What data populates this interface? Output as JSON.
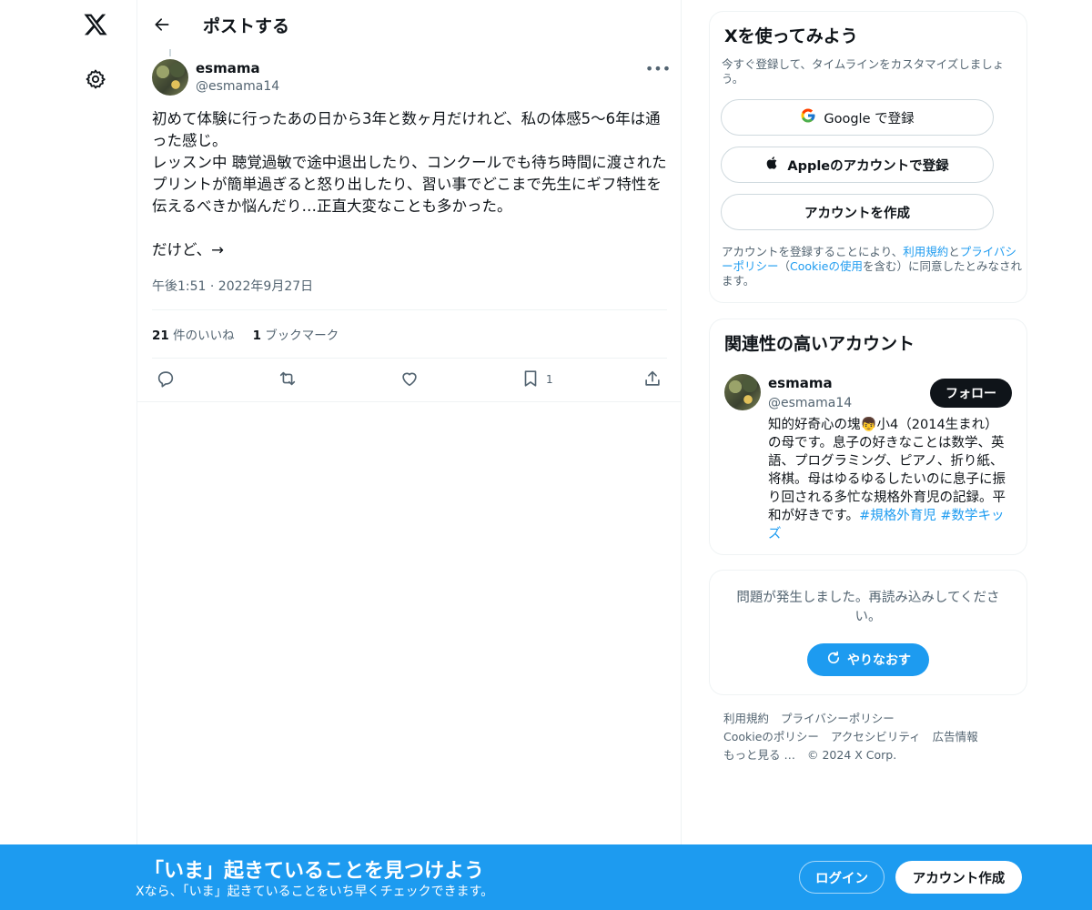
{
  "header": {
    "title": "ポストする"
  },
  "post": {
    "author_name": "esmama",
    "author_handle": "@esmama14",
    "more_label": "•••",
    "text_paragraphs": [
      "初めて体験に行ったあの日から3年と数ヶ月だけれど、私の体感5〜6年は通った感じ。\nレッスン中 聴覚過敏で途中退出したり、コンクールでも待ち時間に渡されたプリントが簡単過ぎると怒り出したり、習い事でどこまで先生にギフ特性を伝えるべきか悩んだり…正直大変なことも多かった。",
      "\nだけど、→"
    ],
    "timestamp": "午後1:51 · 2022年9月27日",
    "likes_count": "21",
    "likes_label": "件のいいね",
    "bookmarks_count": "1",
    "bookmarks_label": "ブックマーク",
    "bookmark_action_count": "1"
  },
  "signup": {
    "title": "Xを使ってみよう",
    "subtitle": "今すぐ登録して、タイムラインをカスタマイズしましょう。",
    "google_label": "Google で登録",
    "apple_label": "Appleのアカウントで登録",
    "create_label": "アカウントを作成",
    "legal_prefix": "アカウントを登録することにより、",
    "legal_terms": "利用規約",
    "legal_and": "と",
    "legal_privacy": "プライバシーポリシー",
    "legal_paren_open": "（",
    "legal_cookie": "Cookieの使用",
    "legal_suffix": "を含む）に同意したとみなされます。"
  },
  "related": {
    "title": "関連性の高いアカウント",
    "name": "esmama",
    "handle": "@esmama14",
    "follow_label": "フォロー",
    "bio": "知的好奇心の塊👦小4（2014生まれ）の母です。息子の好きなことは数学、英語、プログラミング、ピアノ、折り紙、将棋。母はゆるゆるしたいのに息子に振り回される多忙な規格外育児の記録。平和が好きです。",
    "tag1": "#規格外育児",
    "tag2": "#数学キッズ"
  },
  "error": {
    "text": "問題が発生しました。再読み込みしてください。",
    "retry_label": "やりなおす"
  },
  "footer": {
    "row1": [
      "利用規約",
      "プライバシーポリシー"
    ],
    "row2": [
      "Cookieのポリシー",
      "アクセシビリティ",
      "広告情報"
    ],
    "row3": [
      "もっと見る …",
      "© 2024 X Corp."
    ]
  },
  "banner": {
    "title": "「いま」起きていることを見つけよう",
    "subtitle": "Xなら、「いま」起きていることをいち早くチェックできます。",
    "login_label": "ログイン",
    "create_label": "アカウント作成"
  },
  "colors": {
    "accent": "#1d9bf0",
    "text": "#0f1419",
    "secondary": "#536471"
  }
}
